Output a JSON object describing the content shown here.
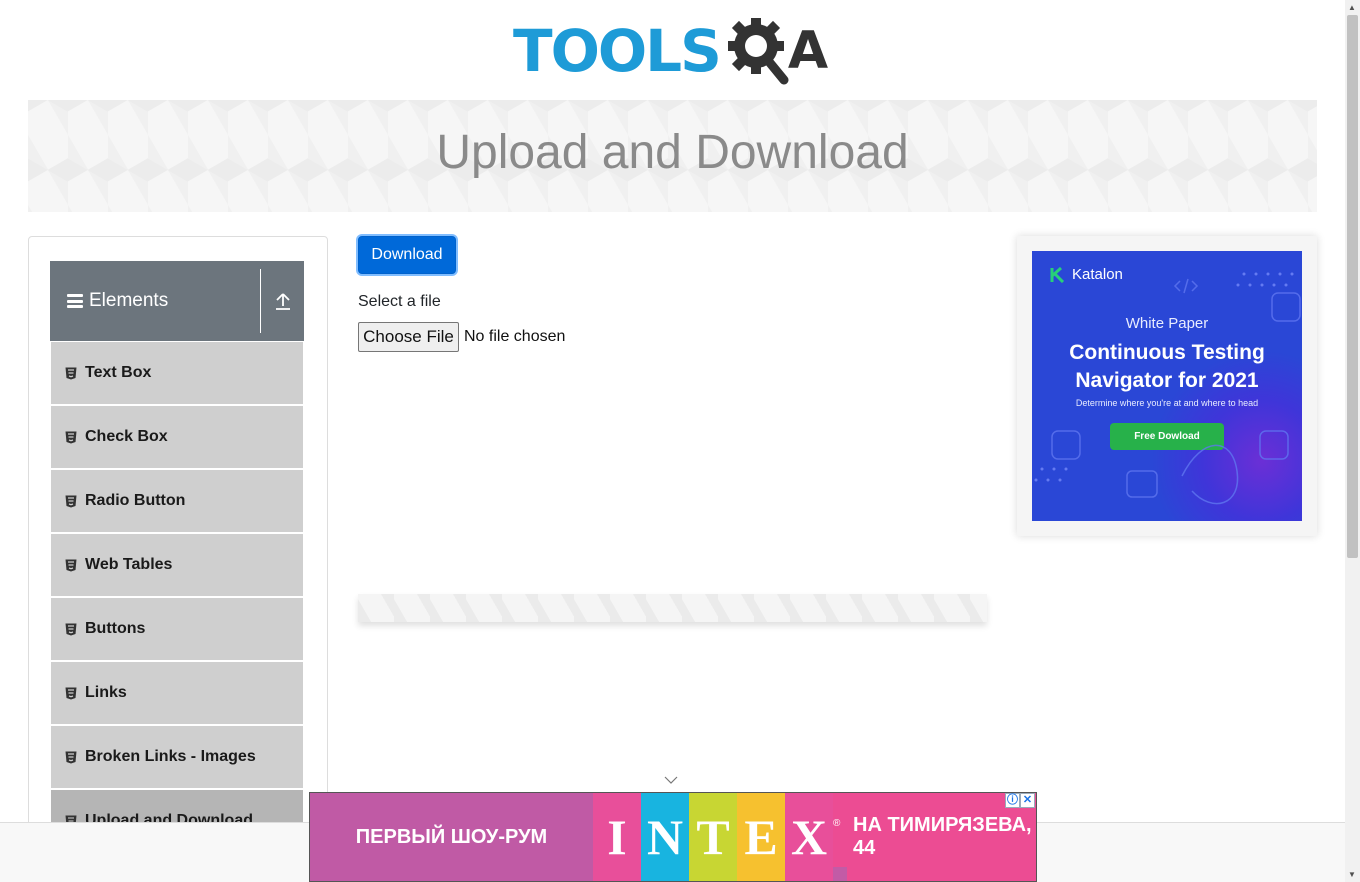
{
  "logo": {
    "text_tools": "TOOLS",
    "text_a": "A"
  },
  "page": {
    "title": "Upload and Download"
  },
  "sidebar": {
    "group_title": "Elements",
    "items": [
      {
        "label": "Text Box"
      },
      {
        "label": "Check Box"
      },
      {
        "label": "Radio Button"
      },
      {
        "label": "Web Tables"
      },
      {
        "label": "Buttons"
      },
      {
        "label": "Links"
      },
      {
        "label": "Broken Links - Images"
      },
      {
        "label": "Upload and Download"
      }
    ]
  },
  "main": {
    "download_label": "Download",
    "select_label": "Select a file",
    "choose_file_label": "Choose File",
    "no_file_text": "No file chosen"
  },
  "right_ad": {
    "brand": "Katalon",
    "subtitle": "White Paper",
    "title_line1": "Continuous Testing",
    "title_line2": "Navigator for 2021",
    "description": "Determine where you're at and where to head",
    "button": "Free Dowload"
  },
  "bottom_ad": {
    "left_text": "ПЕРВЫЙ ШОУ-РУМ",
    "letters": [
      "I",
      "N",
      "T",
      "E",
      "X"
    ],
    "letter_colors": [
      "#e84f9a",
      "#18b4e0",
      "#c8d633",
      "#f6c12f",
      "#e84f9a"
    ],
    "reg_mark": "®",
    "right_text": "НА ТИМИРЯЗЕВА, 44",
    "info_icon_char": "ⓘ",
    "close_icon_char": "✕"
  },
  "colors": {
    "accent": "#1e9bd7",
    "sidebar_header": "#6c757d",
    "menu_item": "#cfcfcf",
    "button_primary": "#0069d9"
  }
}
